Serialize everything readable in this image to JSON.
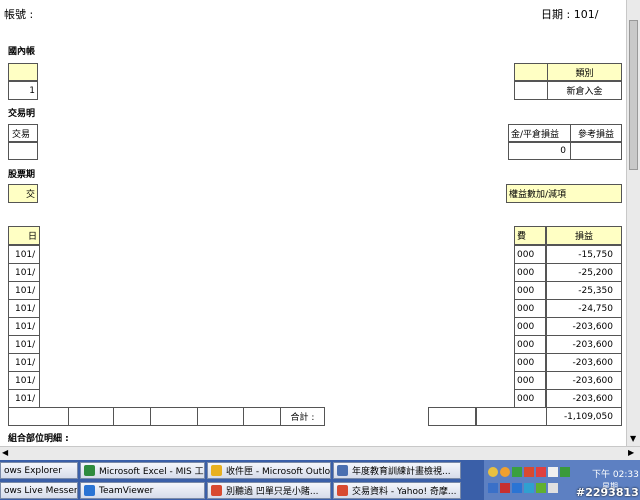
{
  "doc": {
    "account_label": "帳號 :",
    "date_label": "日期 : 101/",
    "sections": {
      "domestic": "國內帳",
      "trade": "交易明",
      "stock": "股票期",
      "combo": "組合部位明細 :"
    },
    "domestic_table": {
      "left_header": "",
      "left_value": "1",
      "category_header": "類別",
      "category_value": "新倉入金"
    },
    "trade_table": {
      "left_header": "交易",
      "pnl_header": "金/平倉損益",
      "ref_pnl_header": "參考損益",
      "pnl_value": "0"
    },
    "stock_table": {
      "left_header": "交",
      "right_header": "權益數加/減項"
    },
    "detail": {
      "date_header": "日",
      "mid_header": "費",
      "pnl_header": "損益",
      "rows": [
        {
          "date": "101/",
          "mid": "000",
          "pnl": "-15,750"
        },
        {
          "date": "101/",
          "mid": "000",
          "pnl": "-25,200"
        },
        {
          "date": "101/",
          "mid": "000",
          "pnl": "-25,350"
        },
        {
          "date": "101/",
          "mid": "000",
          "pnl": "-24,750"
        },
        {
          "date": "101/",
          "mid": "000",
          "pnl": "-203,600"
        },
        {
          "date": "101/",
          "mid": "000",
          "pnl": "-203,600"
        },
        {
          "date": "101/",
          "mid": "000",
          "pnl": "-203,600"
        },
        {
          "date": "101/",
          "mid": "000",
          "pnl": "-203,600"
        },
        {
          "date": "101/",
          "mid": "000",
          "pnl": "-203,600"
        }
      ],
      "total_label": "合計 :",
      "total_pnl": "-1,109,050"
    }
  },
  "taskbar": {
    "row1": [
      {
        "label": "ows Explorer",
        "icon": "folder-icon",
        "color": "#e8c040"
      },
      {
        "label": "Microsoft Excel - MIS 工...",
        "icon": "excel-icon",
        "color": "#2e8b3e"
      },
      {
        "label": "收件匣 - Microsoft Outlo...",
        "icon": "outlook-icon",
        "color": "#e8b020"
      },
      {
        "label": "年度教育訓練計畫檢視...",
        "icon": "document-icon",
        "color": "#4a6fb0"
      }
    ],
    "row2": [
      {
        "label": "ows Live Messen...",
        "icon": "messenger-icon",
        "color": "#3aa040"
      },
      {
        "label": "TeamViewer",
        "icon": "teamviewer-icon",
        "color": "#2a74d4"
      },
      {
        "label": "別聽過 凹單只是小賭...",
        "icon": "chrome-icon",
        "color": "#d84a30"
      },
      {
        "label": "交易資料 - Yahoo! 奇摩...",
        "icon": "chrome-icon",
        "color": "#d84a30"
      }
    ],
    "clock_line1": "下午 02:33",
    "clock_line2": "星期...",
    "watermark": "#2293813"
  }
}
